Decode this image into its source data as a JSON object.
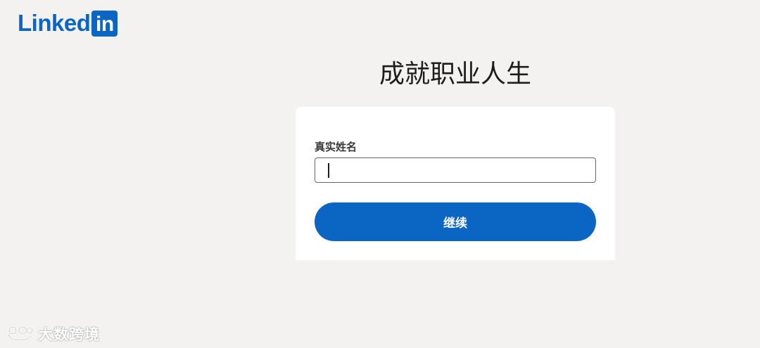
{
  "brand": {
    "logo_text": "Linked",
    "logo_box_text": "in",
    "color": "#0a66c2"
  },
  "main": {
    "headline": "成就职业人生"
  },
  "form": {
    "name_label": "真实姓名",
    "name_value": "",
    "continue_label": "继续"
  },
  "watermark": {
    "text": "大数跨境",
    "icon": "bear-face-icon"
  }
}
